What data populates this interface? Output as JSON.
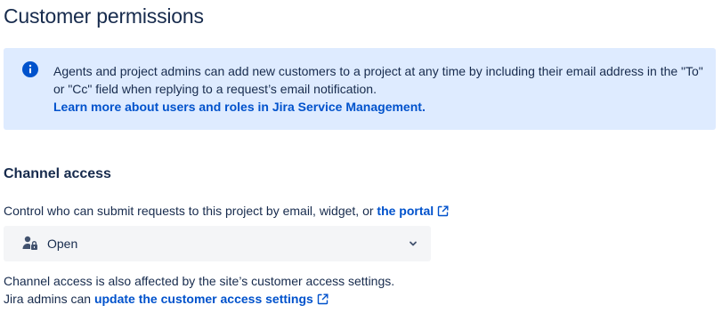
{
  "page": {
    "title": "Customer permissions"
  },
  "info": {
    "text": "Agents and project admins can add new customers to a project at any time by including their email address in the \"To\" or \"Cc\" field when replying to a request’s email notification.",
    "link_label": "Learn more about users and roles in Jira Service Management",
    "link_suffix": ".",
    "icon": "info-icon",
    "accent_color": "#0052cc",
    "background_color": "#deebff"
  },
  "channel_access": {
    "heading": "Channel access",
    "description": "Control who can submit requests to this project by email, widget, or",
    "portal_link": "the portal",
    "select": {
      "value": "Open",
      "icon": "person-lock-icon",
      "chevron": "chevron-down-icon"
    },
    "note_line1": "Channel access is also affected by the site’s customer access settings.",
    "note_line2_prefix": "Jira admins can",
    "note_link": "update the customer access settings"
  }
}
